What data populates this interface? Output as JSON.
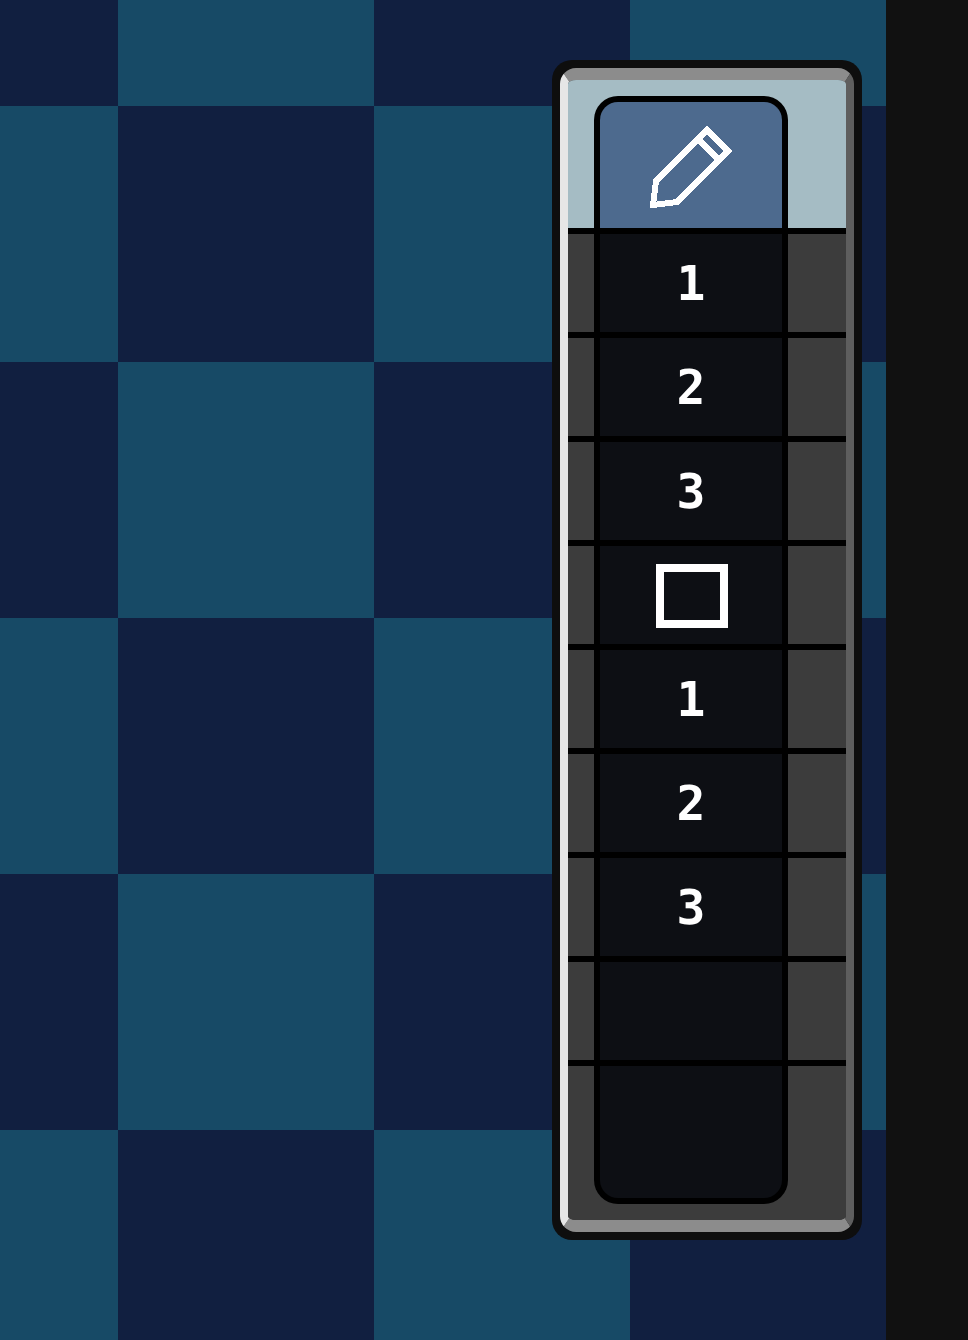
{
  "toolbar": {
    "slots": [
      {
        "kind": "pencil",
        "selected": true
      },
      {
        "kind": "text",
        "label": "1",
        "selected": false
      },
      {
        "kind": "text",
        "label": "2",
        "selected": false
      },
      {
        "kind": "text",
        "label": "3",
        "selected": false
      },
      {
        "kind": "square",
        "selected": false
      },
      {
        "kind": "text",
        "label": "1",
        "selected": false
      },
      {
        "kind": "text",
        "label": "2",
        "selected": false
      },
      {
        "kind": "text",
        "label": "3",
        "selected": false
      },
      {
        "kind": "empty",
        "selected": false
      },
      {
        "kind": "empty",
        "selected": false
      }
    ]
  }
}
